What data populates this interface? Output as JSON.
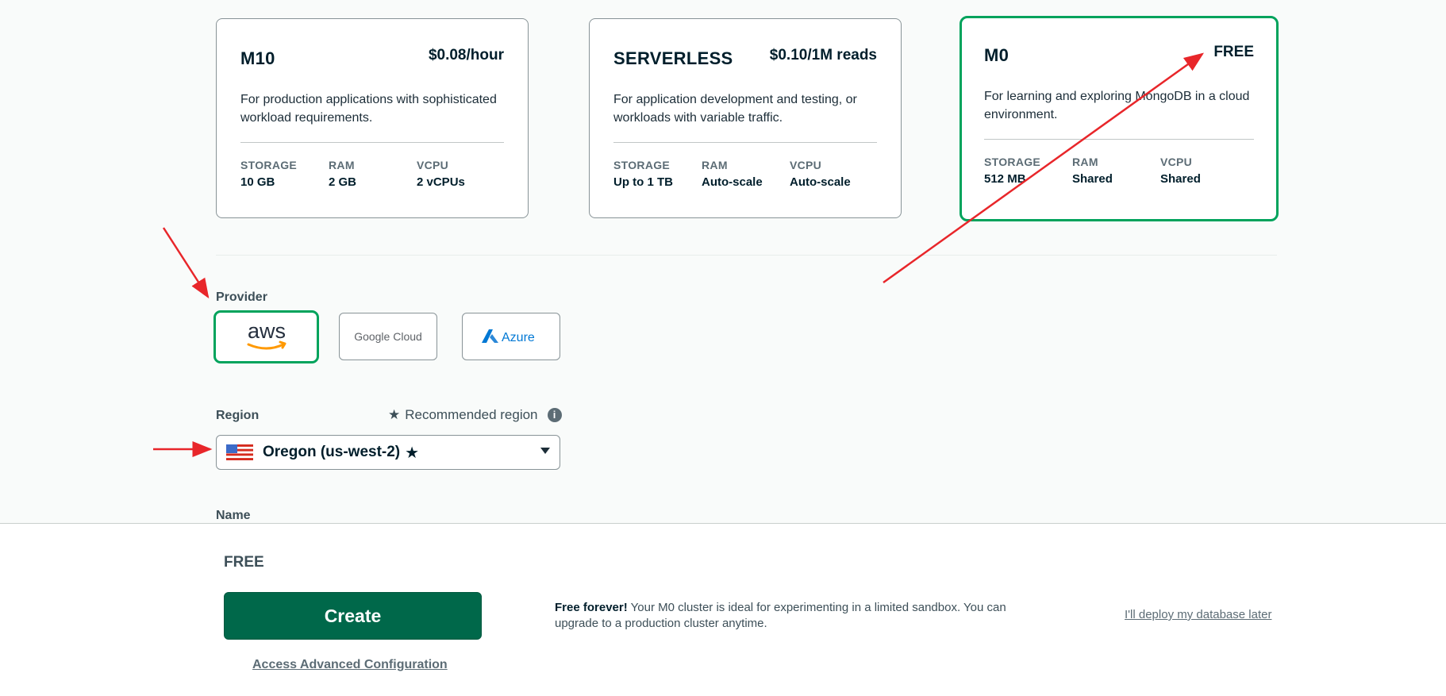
{
  "tiers": [
    {
      "name": "M10",
      "price": "$0.08/hour",
      "description": "For production applications with sophisticated workload requirements.",
      "specs": [
        {
          "label": "STORAGE",
          "value": "10 GB"
        },
        {
          "label": "RAM",
          "value": "2 GB"
        },
        {
          "label": "vCPU",
          "value": "2 vCPUs"
        }
      ]
    },
    {
      "name": "SERVERLESS",
      "price": "$0.10/1M reads",
      "description": "For application development and testing, or workloads with variable traffic.",
      "specs": [
        {
          "label": "STORAGE",
          "value": "Up to 1 TB"
        },
        {
          "label": "RAM",
          "value": "Auto-scale"
        },
        {
          "label": "vCPU",
          "value": "Auto-scale"
        }
      ]
    },
    {
      "name": "M0",
      "price": "FREE",
      "description": "For learning and exploring MongoDB in a cloud environment.",
      "specs": [
        {
          "label": "STORAGE",
          "value": "512 MB"
        },
        {
          "label": "RAM",
          "value": "Shared"
        },
        {
          "label": "vCPU",
          "value": "Shared"
        }
      ]
    }
  ],
  "provider": {
    "label": "Provider",
    "options": [
      {
        "name": "aws",
        "selected": true
      },
      {
        "name": "Google Cloud",
        "selected": false
      },
      {
        "name": "Azure",
        "selected": false
      }
    ]
  },
  "region": {
    "label": "Region",
    "recommended_label": "Recommended region",
    "selected": "Oregon (us-west-2)"
  },
  "name_field": {
    "label": "Name"
  },
  "footer": {
    "tier": "FREE",
    "create_label": "Create",
    "advanced_link": "Access Advanced Configuration",
    "note_bold": "Free forever!",
    "note_text": "Your M0 cluster is ideal for experimenting in a limited sandbox. You can upgrade to a production cluster anytime.",
    "deploy_later": "I'll deploy my database later"
  },
  "colors": {
    "accent": "#00a35c",
    "create": "#00684a",
    "annotation": "#e8262a"
  }
}
